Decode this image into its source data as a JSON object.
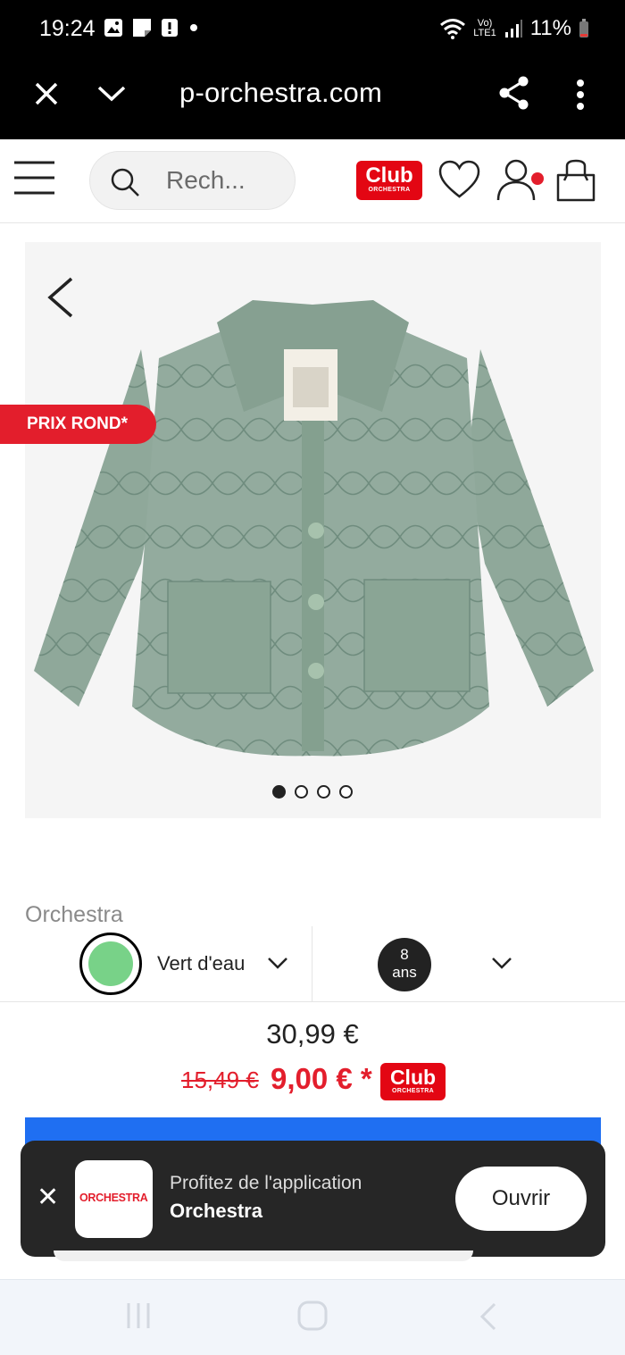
{
  "status_bar": {
    "time": "19:24",
    "battery_percent": "11%",
    "network": "LTE1",
    "icons": [
      "image-icon",
      "note-icon",
      "alert-icon",
      "dot-icon",
      "wifi-icon",
      "signal-icon",
      "battery-icon"
    ]
  },
  "browser": {
    "url": "p-orchestra.com",
    "icons": [
      "close-icon",
      "chevron-down-icon",
      "share-icon",
      "more-icon"
    ]
  },
  "site_header": {
    "search_placeholder": "Rech...",
    "club_label": "Club",
    "club_sub": "ORCHESTRA",
    "icons": [
      "menu-icon",
      "search-icon",
      "heart-icon",
      "account-icon",
      "bag-icon"
    ]
  },
  "gallery": {
    "badge": "PRIX ROND*",
    "image_count": 4,
    "active_index": 0,
    "jacket_color": "#8fa89a"
  },
  "product": {
    "brand": "Orchestra",
    "color_label": "Vert d'eau",
    "color_hex": "#78d288",
    "size_number": "8",
    "size_unit": "ans",
    "price_original": "30,99 €",
    "price_old": "15,49 €",
    "price_new": "9,00 € *",
    "price_color": "#e31e2c"
  },
  "app_banner": {
    "logo_text": "ORCHESTRA",
    "line1": "Profitez de l'application",
    "line2": "Orchestra",
    "open_label": "Ouvrir"
  },
  "colors": {
    "brand_red": "#e30613",
    "cta_blue": "#1f6ff2"
  }
}
